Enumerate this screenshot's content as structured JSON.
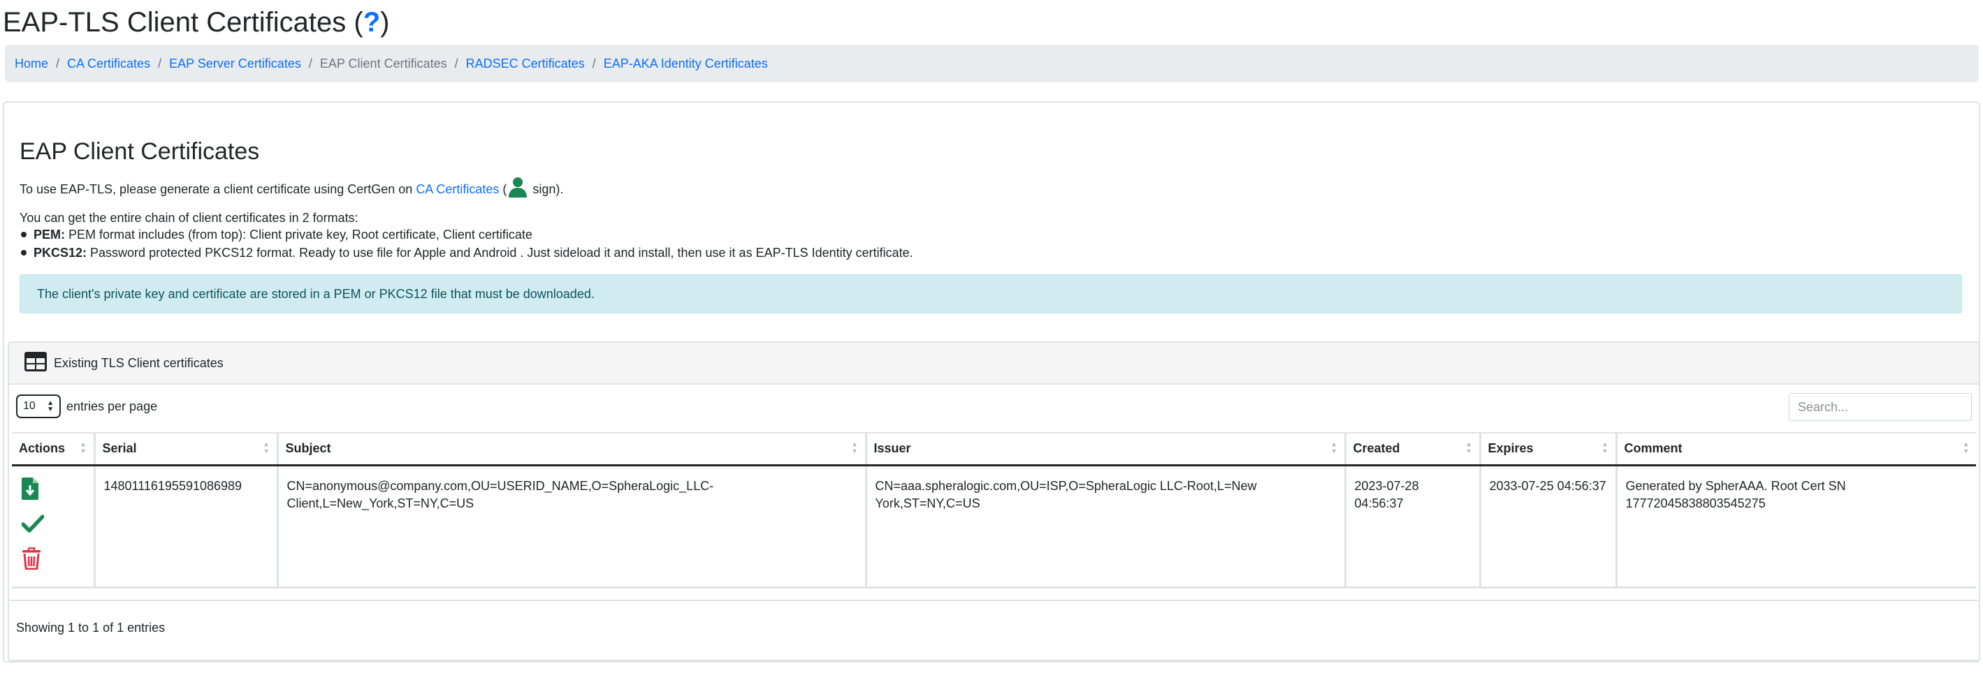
{
  "page": {
    "title": "EAP-TLS Client Certificates (",
    "help_link": "?",
    "title_end": ")"
  },
  "breadcrumb": {
    "separator": "/",
    "items": [
      {
        "label": "Home",
        "active": false
      },
      {
        "label": "CA Certificates",
        "active": false
      },
      {
        "label": "EAP Server Certificates",
        "active": false
      },
      {
        "label": "EAP Client Certificates",
        "active": true
      },
      {
        "label": "RADSEC Certificates",
        "active": false
      },
      {
        "label": "EAP-AKA Identity Certificates",
        "active": false
      }
    ]
  },
  "section": {
    "heading": "EAP Client Certificates",
    "intro_before": "To use EAP-TLS, please generate a client certificate using CertGen on ",
    "intro_link": "CA Certificates",
    "intro_paren_open": " (",
    "intro_after": " sign).",
    "formats_intro": "You can get the entire chain of client certificates in 2 formats:",
    "formats": [
      {
        "label": "PEM:",
        "text": " PEM format includes (from top): Client private key, Root certificate, Client certificate"
      },
      {
        "label": "PKCS12:",
        "text": " Password protected PKCS12 format. Ready to use file for Apple and Android . Just sideload it and install, then use it as EAP-TLS Identity certificate."
      }
    ],
    "alert": "The client's private key and certificate are stored in a PEM or PKCS12 file that must be downloaded."
  },
  "table_card": {
    "header": "Existing TLS Client certificates",
    "entries_value": "10",
    "entries_label": "entries per page",
    "search_placeholder": "Search...",
    "columns": [
      "Actions",
      "Serial",
      "Subject",
      "Issuer",
      "Created",
      "Expires",
      "Comment"
    ],
    "rows": [
      {
        "serial": "14801116195591086989",
        "subject": "CN=anonymous@company.com,OU=USERID_NAME,O=SpheraLogic_LLC-Client,L=New_York,ST=NY,C=US",
        "issuer": "CN=aaa.spheralogic.com,OU=ISP,O=SpheraLogic LLC-Root,L=New York,ST=NY,C=US",
        "created": "2023-07-28 04:56:37",
        "expires": "2033-07-25 04:56:37",
        "comment": "Generated by SpherAAA. Root Cert SN 17772045838803545275"
      }
    ],
    "info": "Showing 1 to 1 of 1 entries"
  },
  "icons": {
    "person": "person-icon",
    "table": "table-icon",
    "download": "file-download-icon",
    "check": "check-icon",
    "delete": "trash-icon"
  },
  "colors": {
    "link": "#0d6efd",
    "success": "#198754",
    "danger": "#dc3545",
    "alert_bg": "#d1ecf1",
    "alert_text": "#0c5460",
    "breadcrumb_bg": "#e9ecef"
  }
}
